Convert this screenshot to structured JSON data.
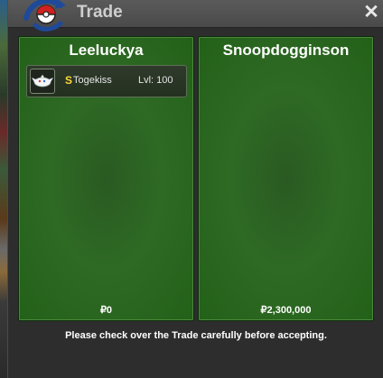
{
  "window": {
    "title": "Trade",
    "close_glyph": "✕"
  },
  "trade": {
    "left": {
      "player": "Leeluckya",
      "money": "₽0",
      "items": [
        {
          "shiny_mark": "S",
          "name": "Togekiss",
          "level": "Lvl: 100",
          "icon": "togekiss-icon"
        }
      ]
    },
    "right": {
      "player": "Snoopdogginson",
      "money": "₽2,300,000",
      "items": []
    }
  },
  "footer": {
    "notice": "Please check over the Trade carefully before accepting."
  },
  "colors": {
    "panel_green": "#2e6a24",
    "shiny_gold": "#ffd83a"
  }
}
